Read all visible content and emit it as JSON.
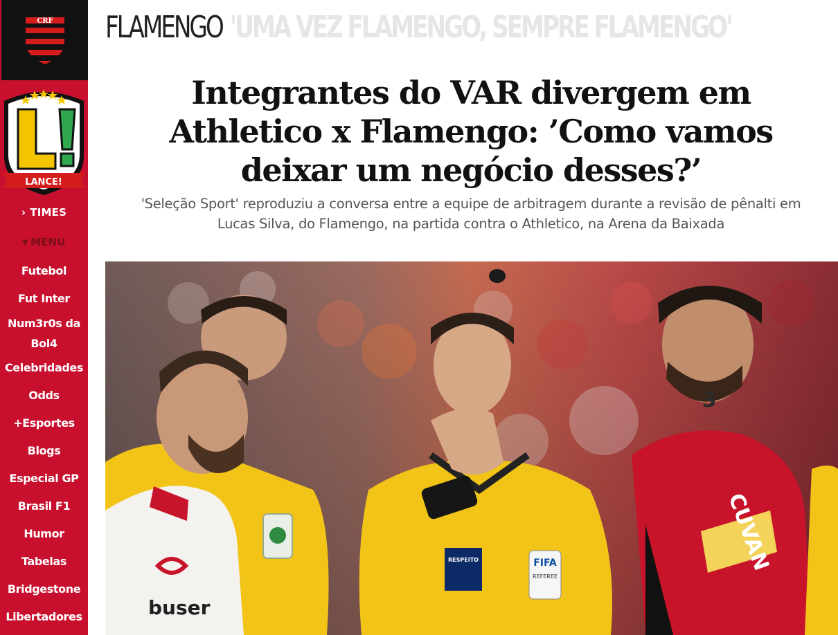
{
  "sidebar": {
    "team_logo_alt": "Flamengo crest",
    "brand_logo_text": "LANCE!",
    "brand_mark": "L!",
    "times_label": "TIMES",
    "menu_label": "MENU",
    "items": [
      {
        "label": "Futebol"
      },
      {
        "label": "Fut Inter"
      },
      {
        "label": "Num3r0s da"
      },
      {
        "label": "Bol4"
      },
      {
        "label": "Celebridades"
      },
      {
        "label": "Odds"
      },
      {
        "label": "+Esportes"
      },
      {
        "label": "Blogs"
      },
      {
        "label": "Especial GP"
      },
      {
        "label": "Brasil F1"
      },
      {
        "label": "Humor"
      },
      {
        "label": "Tabelas"
      },
      {
        "label": "Bridgestone"
      },
      {
        "label": "Libertadores"
      }
    ]
  },
  "header": {
    "section": "FLAMENGO",
    "motto": "'UMA VEZ FLAMENGO, SEMPRE FLAMENGO'"
  },
  "article": {
    "headline": "Integrantes do VAR divergem em Athletico x Flamengo: ’Como vamos deixar um negócio desses?’",
    "subtitle": "'Seleção Sport' reproduziu a conversa entre a equipe de arbitragem durante a revisão de pênalti em Lucas Silva, do Flamengo, na partida contra o Athletico, na Arena da Baixada",
    "photo": {
      "sponsor_text": "buser",
      "player_name_right": "CUVAN",
      "badge_text": "FIFA",
      "badge_sub": "REFEREE",
      "patch_text": "RESPEITO",
      "number_text": "3"
    }
  },
  "colors": {
    "sidebar_red": "#c8102e",
    "flamengo_black": "#111111",
    "referee_yellow": "#f2c418",
    "athletico_red": "#c8142a"
  }
}
